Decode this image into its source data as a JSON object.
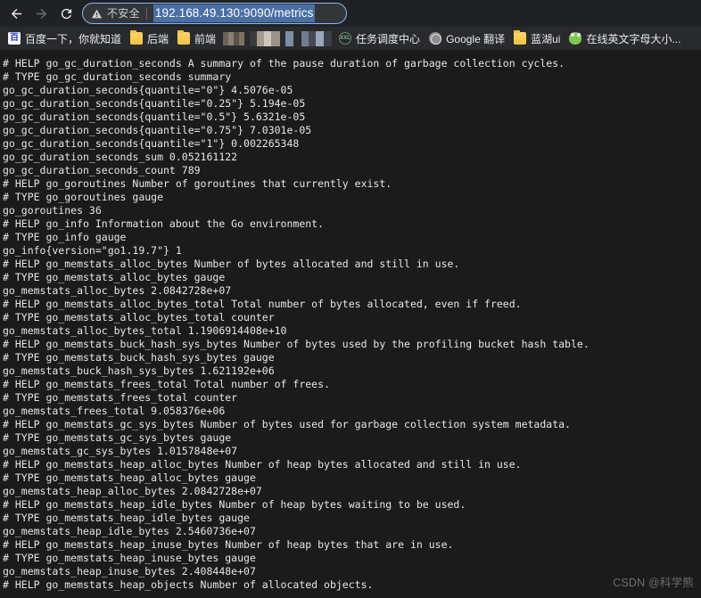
{
  "browser": {
    "back_label": "Back",
    "forward_label": "Forward",
    "reload_label": "Reload",
    "security": {
      "icon": "warning-triangle-icon",
      "label": "不安全"
    },
    "url": "192.168.49.130:9090/metrics",
    "url_selected": true,
    "accent_color": "#8ab4f8",
    "url_selection_color": "#4a6fa5"
  },
  "bookmarks": {
    "items": [
      {
        "icon": "baidu-icon",
        "icon_text": "百",
        "label": "百度一下，你就知道"
      },
      {
        "icon": "folder-icon",
        "icon_text": "",
        "label": "后端"
      },
      {
        "icon": "folder-icon",
        "icon_text": "",
        "label": "前端"
      },
      {
        "icon": "mosaic-a",
        "icon_text": "",
        "label": ""
      },
      {
        "icon": "mosaic-b",
        "icon_text": "",
        "label": ""
      },
      {
        "icon": "mosaic-c",
        "icon_text": "",
        "label": ""
      },
      {
        "icon": "xxl-icon",
        "icon_text": "XXL",
        "label": "任务调度中心"
      },
      {
        "icon": "google-icon",
        "icon_text": "",
        "label": "Google 翻译"
      },
      {
        "icon": "folder-icon",
        "icon_text": "",
        "label": "蓝湖ui"
      },
      {
        "icon": "frog-icon",
        "icon_text": "",
        "label": "在线英文字母大小..."
      }
    ]
  },
  "page": {
    "background_color": "#1b1b1b",
    "text_color": "#e8e6e3",
    "metrics_text": "# HELP go_gc_duration_seconds A summary of the pause duration of garbage collection cycles.\n# TYPE go_gc_duration_seconds summary\ngo_gc_duration_seconds{quantile=\"0\"} 4.5076e-05\ngo_gc_duration_seconds{quantile=\"0.25\"} 5.194e-05\ngo_gc_duration_seconds{quantile=\"0.5\"} 5.6321e-05\ngo_gc_duration_seconds{quantile=\"0.75\"} 7.0301e-05\ngo_gc_duration_seconds{quantile=\"1\"} 0.002265348\ngo_gc_duration_seconds_sum 0.052161122\ngo_gc_duration_seconds_count 789\n# HELP go_goroutines Number of goroutines that currently exist.\n# TYPE go_goroutines gauge\ngo_goroutines 36\n# HELP go_info Information about the Go environment.\n# TYPE go_info gauge\ngo_info{version=\"go1.19.7\"} 1\n# HELP go_memstats_alloc_bytes Number of bytes allocated and still in use.\n# TYPE go_memstats_alloc_bytes gauge\ngo_memstats_alloc_bytes 2.0842728e+07\n# HELP go_memstats_alloc_bytes_total Total number of bytes allocated, even if freed.\n# TYPE go_memstats_alloc_bytes_total counter\ngo_memstats_alloc_bytes_total 1.1906914408e+10\n# HELP go_memstats_buck_hash_sys_bytes Number of bytes used by the profiling bucket hash table.\n# TYPE go_memstats_buck_hash_sys_bytes gauge\ngo_memstats_buck_hash_sys_bytes 1.621192e+06\n# HELP go_memstats_frees_total Total number of frees.\n# TYPE go_memstats_frees_total counter\ngo_memstats_frees_total 9.058376e+06\n# HELP go_memstats_gc_sys_bytes Number of bytes used for garbage collection system metadata.\n# TYPE go_memstats_gc_sys_bytes gauge\ngo_memstats_gc_sys_bytes 1.0157848e+07\n# HELP go_memstats_heap_alloc_bytes Number of heap bytes allocated and still in use.\n# TYPE go_memstats_heap_alloc_bytes gauge\ngo_memstats_heap_alloc_bytes 2.0842728e+07\n# HELP go_memstats_heap_idle_bytes Number of heap bytes waiting to be used.\n# TYPE go_memstats_heap_idle_bytes gauge\ngo_memstats_heap_idle_bytes 2.5460736e+07\n# HELP go_memstats_heap_inuse_bytes Number of heap bytes that are in use.\n# TYPE go_memstats_heap_inuse_bytes gauge\ngo_memstats_heap_inuse_bytes 2.408448e+07\n# HELP go_memstats_heap_objects Number of allocated objects."
  },
  "watermark": {
    "text": "CSDN @科学熊"
  }
}
